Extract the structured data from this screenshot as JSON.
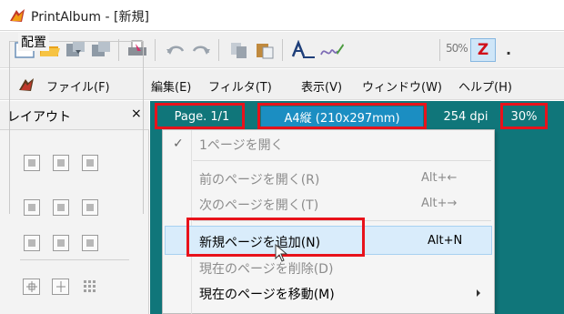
{
  "window": {
    "title": "PrintAlbum - [新規]"
  },
  "toolbar": {
    "icons": [
      "new-document-icon",
      "open-folder-icon",
      "import-icon",
      "export-icon",
      "print-icon",
      "undo-icon",
      "redo-icon",
      "copy-icon",
      "paste-icon",
      "text-tool-icon",
      "signature-tool-icon",
      "zoom-50-icon",
      "z-order-icon"
    ],
    "zoom_fifty_label": "50%",
    "z_label": "Z",
    "extra_label": "."
  },
  "menubar": {
    "items": [
      "ファイル(F)",
      "編集(E)",
      "フィルタ(T)",
      "表示(V)",
      "ウィンドウ(W)",
      "ヘルプ(H)"
    ]
  },
  "left_panel": {
    "title": "レイアウト",
    "close_label": "×",
    "group_label": "配置"
  },
  "status": {
    "page": "Page. 1/1",
    "paper": "A4縦 (210x297mm)",
    "dpi": "254 dpi",
    "zoom": "30%"
  },
  "context_menu": {
    "items": [
      {
        "label": "1ページを開く",
        "shortcut": "",
        "enabled": false,
        "checked": true
      },
      {
        "label": "前のページを開く(R)",
        "shortcut": "Alt+←",
        "enabled": false
      },
      {
        "label": "次のページを開く(T)",
        "shortcut": "Alt+→",
        "enabled": false
      },
      {
        "label": "新規ページを追加(N)",
        "shortcut": "Alt+N",
        "enabled": true,
        "highlighted": true
      },
      {
        "label": "現在のページを削除(D)",
        "shortcut": "",
        "enabled": false
      },
      {
        "label": "現在のページを移動(M)",
        "shortcut": "",
        "enabled": true,
        "submenu": true
      }
    ]
  },
  "colors": {
    "workarea": "#10767a",
    "highlight_border": "#e8121b",
    "menu_highlight": "#d9ecfb",
    "z_red": "#d0101a"
  }
}
